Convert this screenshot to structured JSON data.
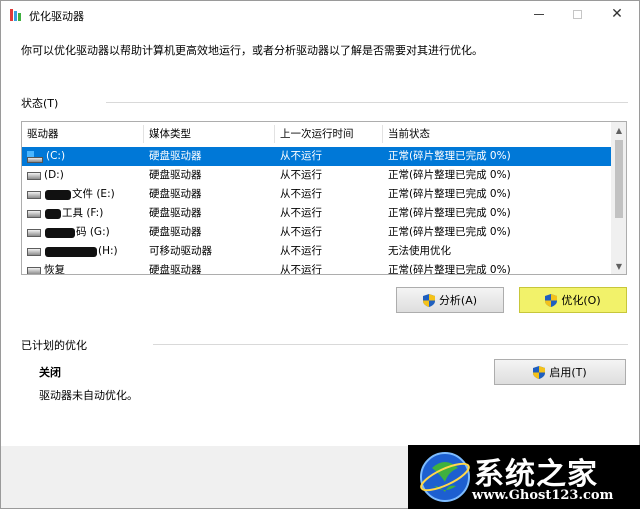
{
  "window": {
    "title": "优化驱动器",
    "description": "你可以优化驱动器以帮助计算机更高效地运行，或者分析驱动器以了解是否需要对其进行优化。"
  },
  "status_group": {
    "label": "状态(T)"
  },
  "table": {
    "columns": [
      "驱动器",
      "媒体类型",
      "上一次运行时间",
      "当前状态"
    ],
    "rows": [
      {
        "drive_prefix": "",
        "drive_suffix": "(C:)",
        "media": "硬盘驱动器",
        "last_run": "从不运行",
        "status": "正常(碎片整理已完成 0%)"
      },
      {
        "drive_prefix": "",
        "drive_suffix": "(D:)",
        "media": "硬盘驱动器",
        "last_run": "从不运行",
        "status": "正常(碎片整理已完成 0%)"
      },
      {
        "drive_prefix": "",
        "drive_suffix": "文件 (E:)",
        "media": "硬盘驱动器",
        "last_run": "从不运行",
        "status": "正常(碎片整理已完成 0%)"
      },
      {
        "drive_prefix": "",
        "drive_suffix": "工具 (F:)",
        "media": "硬盘驱动器",
        "last_run": "从不运行",
        "status": "正常(碎片整理已完成 0%)"
      },
      {
        "drive_prefix": "",
        "drive_suffix": "码 (G:)",
        "media": "硬盘驱动器",
        "last_run": "从不运行",
        "status": "正常(碎片整理已完成 0%)"
      },
      {
        "drive_prefix": "",
        "drive_suffix": "(H:)",
        "media": "可移动驱动器",
        "last_run": "从不运行",
        "status": "无法使用优化"
      },
      {
        "drive_prefix": "",
        "drive_suffix": "恢复",
        "media": "硬盘驱动器",
        "last_run": "从不运行",
        "status": "正常(碎片整理已完成 0%)"
      }
    ]
  },
  "buttons": {
    "analyze": "分析(A)",
    "optimize": "优化(O)",
    "enable": "启用(T)"
  },
  "scheduled": {
    "label": "已计划的优化",
    "status": "关闭",
    "description": "驱动器未自动优化。"
  },
  "watermark": {
    "title": "系统之家",
    "url": "www.Ghost123.com"
  },
  "colors": {
    "selection": "#0078d7",
    "highlight": "#f2f26a",
    "shield_blue": "#1f5fbf",
    "shield_yellow": "#f4c21a"
  }
}
